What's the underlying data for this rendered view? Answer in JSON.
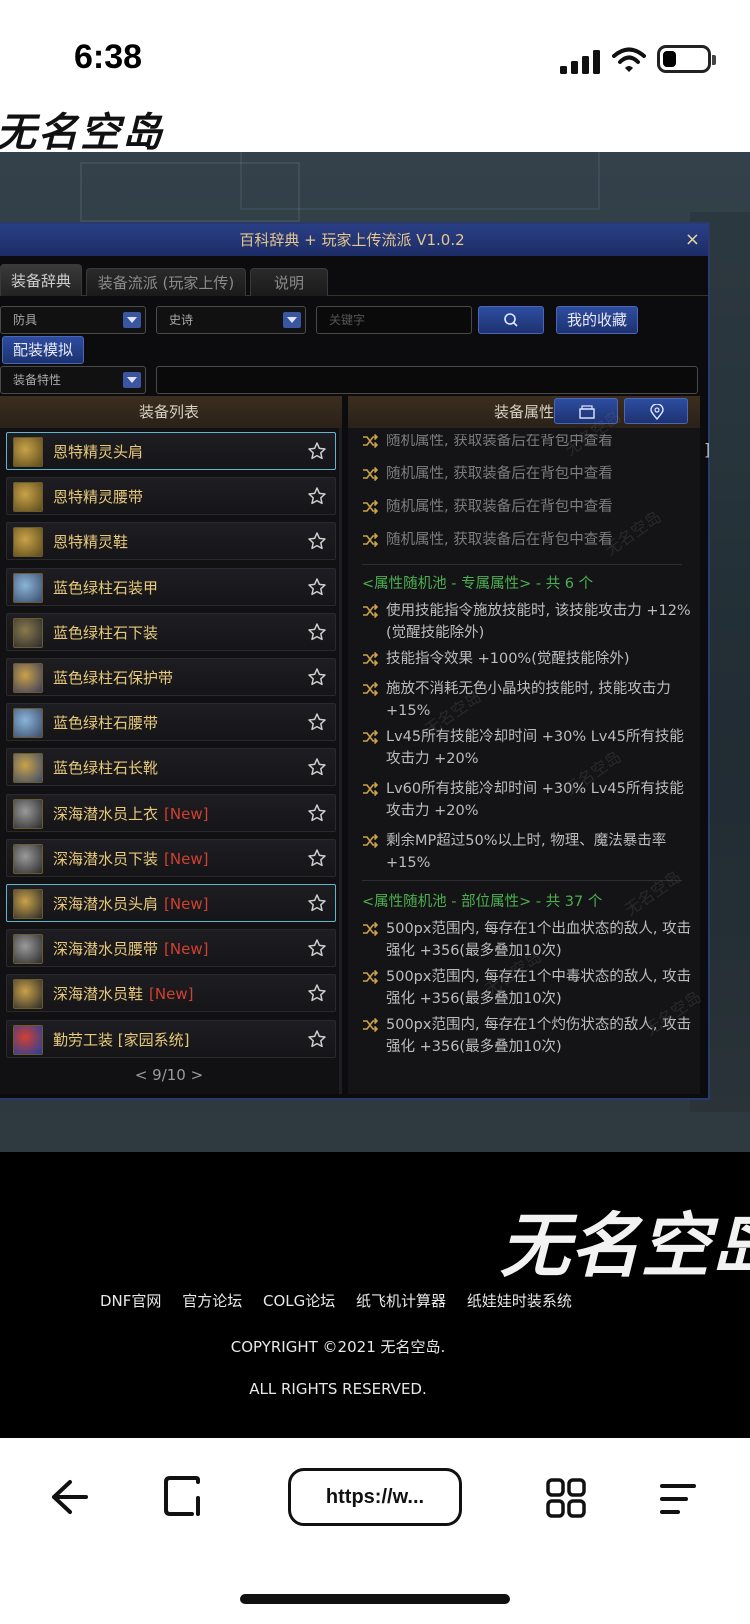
{
  "status_bar": {
    "time": "6:38",
    "battery_level": 0.3
  },
  "site": {
    "logo_text": "无名空岛"
  },
  "window": {
    "title": "百科辞典 + 玩家上传流派 V1.0.2",
    "close_label": "×",
    "tabs": [
      {
        "label": "装备辞典",
        "active": true
      },
      {
        "label": "装备流派 (玩家上传)",
        "active": false
      },
      {
        "label": "说明",
        "active": false
      }
    ],
    "filters": {
      "type_select": "防具",
      "rarity_select": "史诗",
      "keyword_placeholder": "关键字",
      "favorites_label": "我的收藏",
      "simulate_label": "配装模拟",
      "trait_select": "装备特性",
      "trait_input": ""
    },
    "list_panel": {
      "title": "装备列表",
      "items": [
        {
          "name": "恩特精灵头肩",
          "new": "",
          "selected": true
        },
        {
          "name": "恩特精灵腰带",
          "new": "",
          "selected": false
        },
        {
          "name": "恩特精灵鞋",
          "new": "",
          "selected": false
        },
        {
          "name": "蓝色绿柱石装甲",
          "new": "",
          "selected": false
        },
        {
          "name": "蓝色绿柱石下装",
          "new": "",
          "selected": false
        },
        {
          "name": "蓝色绿柱石保护带",
          "new": "",
          "selected": false
        },
        {
          "name": "蓝色绿柱石腰带",
          "new": "",
          "selected": false
        },
        {
          "name": "蓝色绿柱石长靴",
          "new": "",
          "selected": false
        },
        {
          "name": "深海潜水员上衣",
          "new": "[New]",
          "selected": false
        },
        {
          "name": "深海潜水员下装",
          "new": "[New]",
          "selected": false
        },
        {
          "name": "深海潜水员头肩",
          "new": "[New]",
          "selected": true
        },
        {
          "name": "深海潜水员腰带",
          "new": "[New]",
          "selected": false
        },
        {
          "name": "深海潜水员鞋",
          "new": "[New]",
          "selected": false
        },
        {
          "name": "勤劳工装 [家园系统]",
          "new": "",
          "selected": false
        }
      ],
      "pager": "<  9/10  >"
    },
    "attr_panel": {
      "title": "装备属性",
      "random_lines": [
        "随机属性, 获取装备后在背包中查看",
        "随机属性, 获取装备后在背包中查看",
        "随机属性, 获取装备后在背包中查看",
        "随机属性, 获取装备后在背包中查看"
      ],
      "pool1_title": "<属性随机池 - 专属属性> - 共 6 个",
      "pool1": [
        "使用技能指令施放技能时, 该技能攻击力 +12%(觉醒技能除外)",
        "技能指令效果 +100%(觉醒技能除外)",
        "施放不消耗无色小晶块的技能时, 技能攻击力 +15%",
        "Lv45所有技能冷却时间 +30% Lv45所有技能攻击力 +20%",
        "Lv60所有技能冷却时间 +30% Lv45所有技能攻击力 +20%",
        "剩余MP超过50%以上时, 物理、魔法暴击率 +15%"
      ],
      "pool2_title": "<属性随机池 - 部位属性> - 共 37 个",
      "pool2": [
        "500px范围内, 每存在1个出血状态的敌人, 攻击强化 +356(最多叠加10次)",
        "500px范围内, 每存在1个中毒状态的敌人, 攻击强化 +356(最多叠加10次)",
        "500px范围内, 每存在1个灼伤状态的敌人, 攻击强化 +356(最多叠加10次)"
      ],
      "side_bracket": "]"
    }
  },
  "footer": {
    "logo_text": "无名空岛",
    "links": [
      "DNF官网",
      "官方论坛",
      "COLG论坛",
      "纸飞机计算器",
      "纸娃娃时装系统"
    ],
    "copyright": "COPYRIGHT ©2021 无名空岛.",
    "rights": "ALL RIGHTS RESERVED."
  },
  "browser": {
    "url": "https://w..."
  },
  "colors": {
    "gold": "#e8c97a",
    "green": "#4caf50",
    "new_red": "#d04030",
    "accent_blue": "#2e4da0"
  }
}
